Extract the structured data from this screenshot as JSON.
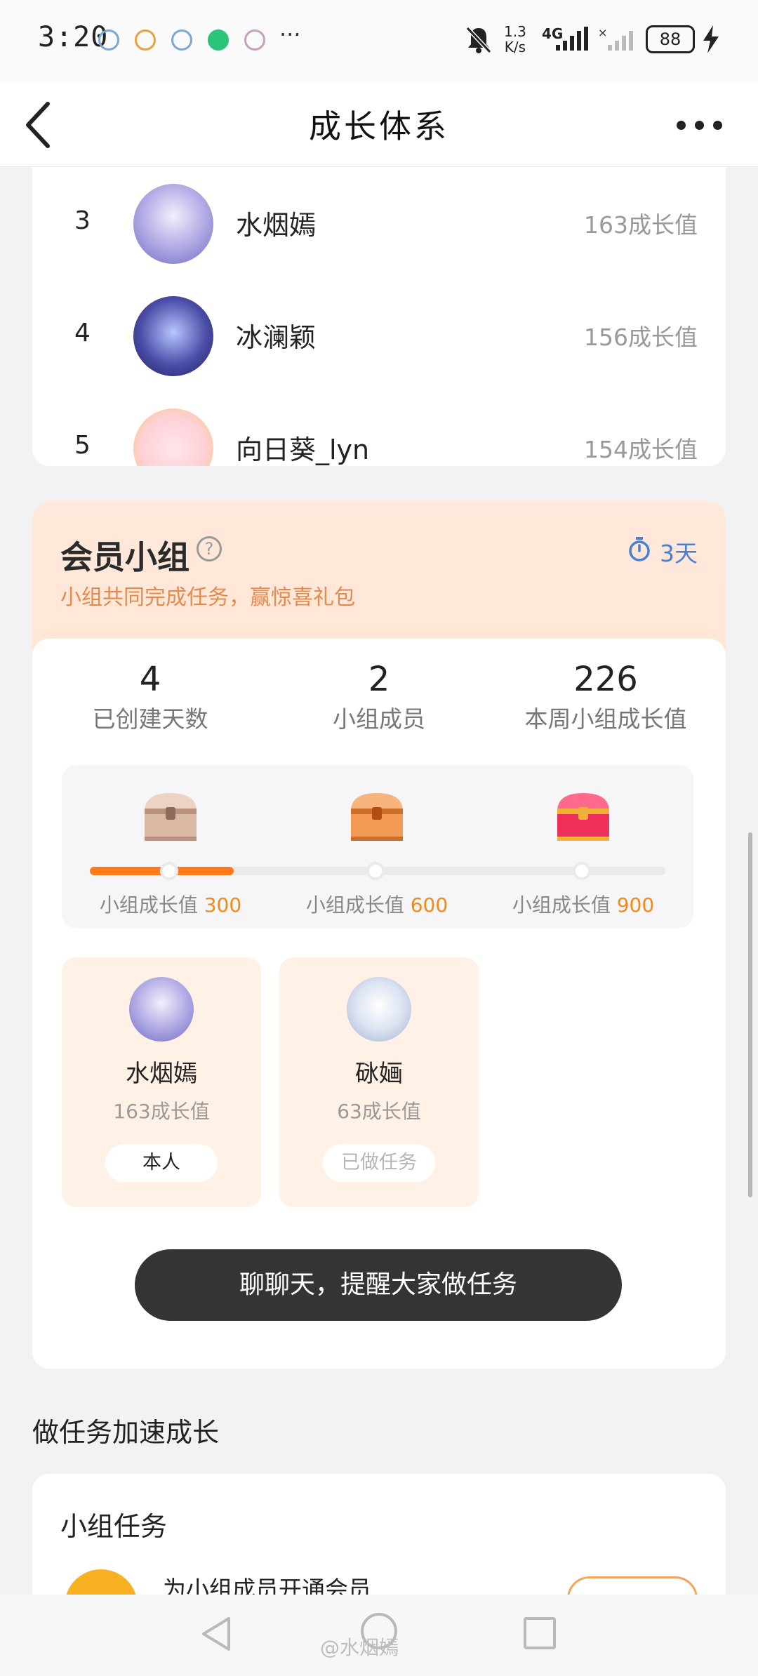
{
  "status_bar": {
    "time": "3:20",
    "dots": "···",
    "speed_top": "1.3",
    "speed_bottom": "K/s",
    "network": "4G",
    "battery": "88"
  },
  "nav": {
    "title": "成长体系"
  },
  "ranking": [
    {
      "rank": "3",
      "name": "水烟嫣",
      "score": "163成长值"
    },
    {
      "rank": "4",
      "name": "冰澜颖",
      "score": "156成长值"
    },
    {
      "rank": "5",
      "name": "向日葵_lyn",
      "score": "154成长值"
    }
  ],
  "group": {
    "title": "会员小组",
    "help_symbol": "?",
    "subtitle": "小组共同完成任务，赢惊喜礼包",
    "timer": "3天",
    "stats": [
      {
        "value": "4",
        "label": "已创建天数"
      },
      {
        "value": "2",
        "label": "小组成员"
      },
      {
        "value": "226",
        "label": "本周小组成长值"
      }
    ],
    "milestones": [
      {
        "label": "小组成长值",
        "value": "300"
      },
      {
        "label": "小组成长值",
        "value": "600"
      },
      {
        "label": "小组成长值",
        "value": "900"
      }
    ],
    "progress_fraction": 0.25,
    "members": [
      {
        "name": "水烟嫣",
        "score": "163成长值",
        "tag": "本人"
      },
      {
        "name": "砯婳",
        "score": "63成长值",
        "tag": "已做任务"
      }
    ],
    "chat_button": "聊聊天，提醒大家做任务"
  },
  "tasks_section": {
    "title": "做任务加速成长",
    "card_title": "小组任务",
    "task_name": "为小组成员开通会员"
  },
  "watermark": "@水烟嫣",
  "colors": {
    "accent_orange": "#ff7a1a",
    "milestone_value": "#f28a17",
    "timer_blue": "#4a7ed1",
    "chat_button_bg": "#343434"
  }
}
